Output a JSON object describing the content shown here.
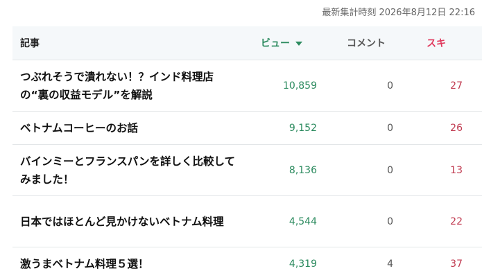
{
  "timestamp": "最新集計時刻 2026年8月12日 22:16",
  "headers": {
    "article": "記事",
    "views": "ビュー",
    "comments": "コメント",
    "likes": "スキ"
  },
  "rows": [
    {
      "title": "つぶれそうで潰れない！？インド料理店の“裏の収益モデル”を解説",
      "views": "10,859",
      "comments": "0",
      "likes": "27"
    },
    {
      "title": "ベトナムコーヒーのお話",
      "views": "9,152",
      "comments": "0",
      "likes": "26"
    },
    {
      "title": "バインミーとフランスパンを詳しく比較してみました！",
      "views": "8,136",
      "comments": "0",
      "likes": "13"
    },
    {
      "title": "日本ではほとんど見かけないベトナム料理",
      "views": "4,544",
      "comments": "0",
      "likes": "22"
    },
    {
      "title": "激うまベトナム料理５選！",
      "views": "4,319",
      "comments": "4",
      "likes": "37"
    }
  ],
  "colors": {
    "views": "#2b8a5e",
    "likes": "#e0375b",
    "header_bg": "#f5f8fa"
  },
  "icons": {
    "sort": "triangle-down-icon"
  }
}
